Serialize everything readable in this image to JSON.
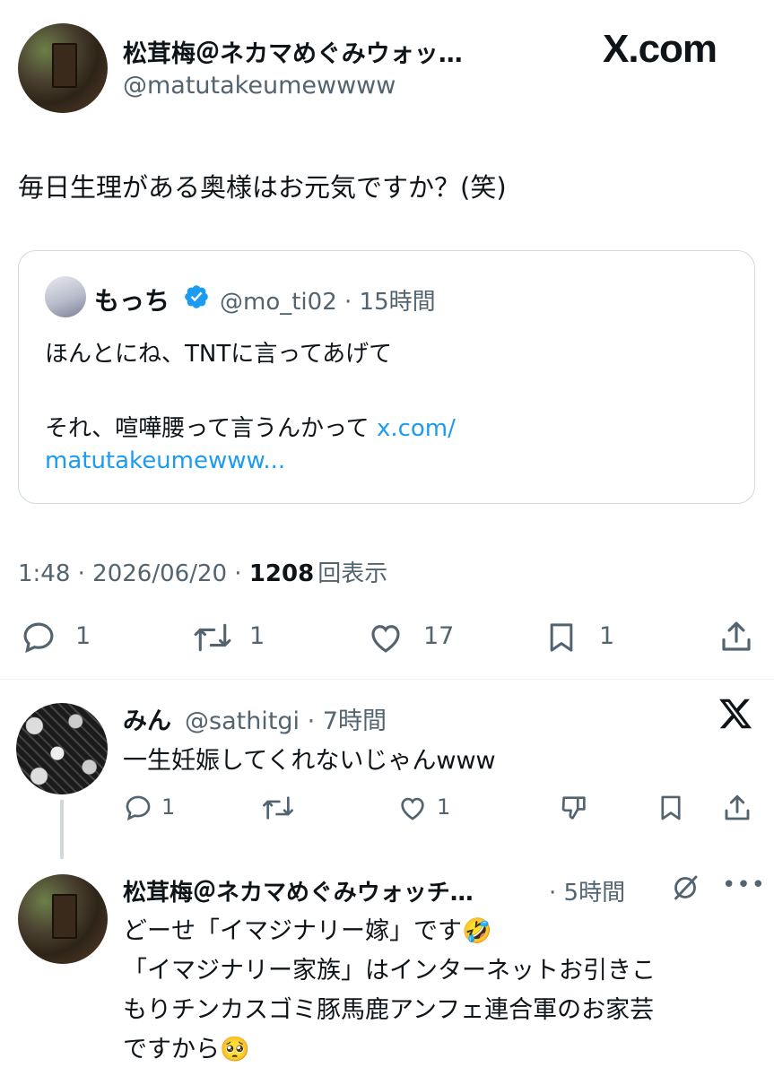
{
  "main_tweet": {
    "author_name": "松茸梅＠ネカマめぐみウォッ…",
    "author_handle": "@matutakeumewwww",
    "brand": "X.com",
    "text": "毎日生理がある奥様はお元気ですか？(笑)",
    "quoted": {
      "author_name": "もっち",
      "meta": "@mo_ti02 · 15時間",
      "line1": "ほんとにね、TNTに言ってあげて",
      "line2": "それ、喧嘩腰って言うんかって",
      "link_part1": "x.com/",
      "link_part2": "matutakeumewww..."
    },
    "time": "1:48 · 2026/06/20 · ",
    "views_count": "1208",
    "views_label": "回表示",
    "actions": {
      "replies": "1",
      "retweets": "1",
      "likes": "17",
      "bookmarks": "1"
    }
  },
  "reply1": {
    "author_name": "みん",
    "meta": "@sathitgi · 7時間",
    "text": "一生妊娠してくれないじゃんwww",
    "actions": {
      "replies": "1",
      "likes": "1"
    }
  },
  "reply2": {
    "author_name": "松茸梅＠ネカマめぐみウォッチ…",
    "meta": "· 5時間",
    "line1": "どーせ「イマジナリー嫁」です🤣",
    "line2": "「イマジナリー家族」はインターネットお引きこ",
    "line3": "もりチンカスゴミ豚馬鹿アンフェ連合軍のお家芸",
    "line4": "ですから🥺"
  },
  "colors": {
    "link": "#1d9bf0",
    "secondary": "#536471",
    "primary": "#0f1419",
    "border": "#cfd9de"
  }
}
